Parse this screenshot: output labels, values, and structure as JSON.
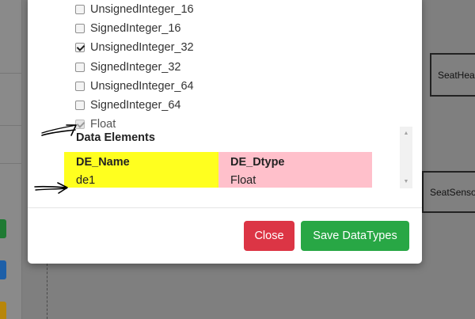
{
  "background": {
    "nodes": [
      {
        "label": "SeatHea"
      },
      {
        "label": "SeatSenso"
      }
    ]
  },
  "modal": {
    "data_types": [
      {
        "label": "UnsignedInteger_16",
        "checked": false,
        "disabled": false
      },
      {
        "label": "SignedInteger_16",
        "checked": false,
        "disabled": false
      },
      {
        "label": "UnsignedInteger_32",
        "checked": true,
        "disabled": false
      },
      {
        "label": "SignedInteger_32",
        "checked": false,
        "disabled": false
      },
      {
        "label": "UnsignedInteger_64",
        "checked": false,
        "disabled": false
      },
      {
        "label": "SignedInteger_64",
        "checked": false,
        "disabled": false
      },
      {
        "label": "Float",
        "checked": true,
        "disabled": true
      }
    ],
    "data_elements": {
      "title": "Data Elements",
      "columns": [
        "DE_Name",
        "DE_Dtype"
      ],
      "rows": [
        {
          "name": "de1",
          "dtype": "Float"
        }
      ]
    },
    "buttons": {
      "close_label": "Close",
      "save_label": "Save DataTypes"
    }
  },
  "colors": {
    "close": "#dc3545",
    "save": "#28a745",
    "name_column": "#ffff1f",
    "dtype_column": "#ffc0cb"
  }
}
